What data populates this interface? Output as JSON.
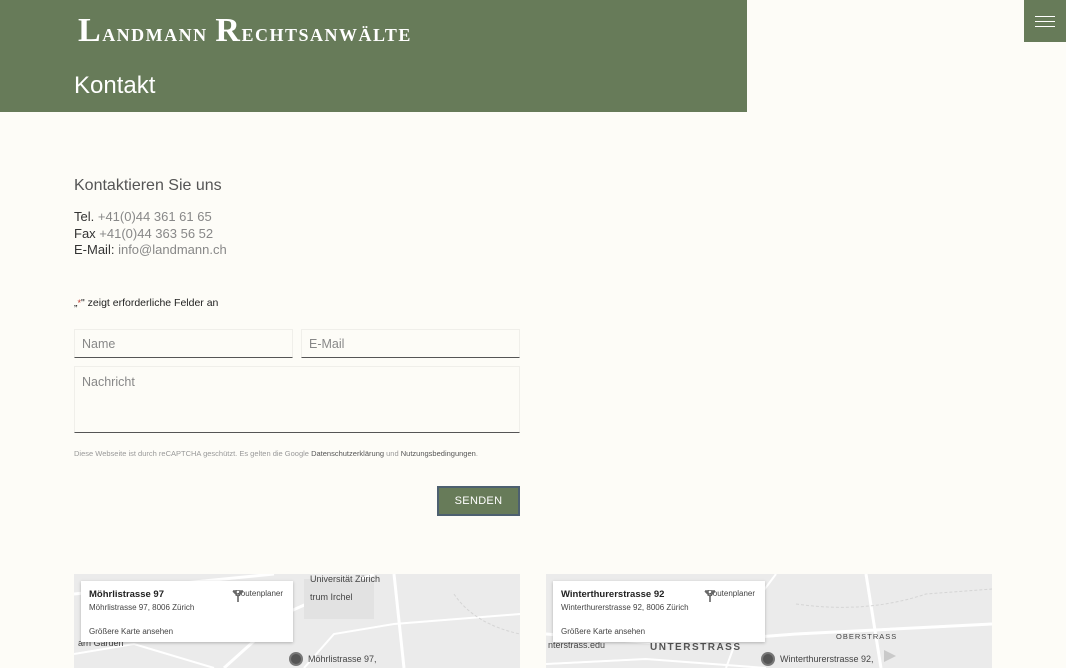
{
  "header": {
    "logo_first_initial": "L",
    "logo_first_rest": "andmann",
    "logo_second_initial": "R",
    "logo_second_rest": "echtsanwälte",
    "page_title": "Kontakt",
    "menu_icon": "hamburger-icon"
  },
  "contact": {
    "heading": "Kontaktieren Sie uns",
    "tel_label": "Tel.",
    "tel_value": "+41(0)44 361 61 65",
    "fax_label": "Fax",
    "fax_value": "+41(0)44 363 56 52",
    "email_label": "E-Mail:",
    "email_value": "info@landmann.ch"
  },
  "form": {
    "required_note_prefix": "„",
    "required_note_star": "*",
    "required_note_text": "\" zeigt erforderliche Felder an",
    "name_placeholder": "Name",
    "email_placeholder": "E-Mail",
    "message_placeholder": "Nachricht",
    "recaptcha_text": "Diese Webseite ist durch reCAPTCHA geschützt. Es gelten die Google",
    "recaptcha_privacy": "Datenschutzerklärung",
    "recaptcha_and": "und",
    "recaptcha_terms": "Nutzungsbedingungen",
    "recaptcha_end": ".",
    "send_label": "SENDEN"
  },
  "maps": [
    {
      "title": "Möhrlistrasse 97",
      "address": "Möhrlistrasse 97, 8006 Zürich",
      "route_label": "Routenplaner",
      "larger_map": "Größere Karte ansehen",
      "labels": {
        "university": "Universität Zürich",
        "irchel": "trum Irchel",
        "pin_label": "Möhrlistrasse 97,",
        "garden": "arn Garden"
      }
    },
    {
      "title": "Winterthurerstrasse 92",
      "address": "Winterthurerstrasse 92, 8006 Zürich",
      "route_label": "Routenplaner",
      "larger_map": "Größere Karte ansehen",
      "labels": {
        "district": "UNTERSTRASS",
        "oberstrass": "OBERSTRASS",
        "edu": "nterstrass.edu",
        "pin_label": "Winterthurerstrasse 92,"
      }
    }
  ]
}
